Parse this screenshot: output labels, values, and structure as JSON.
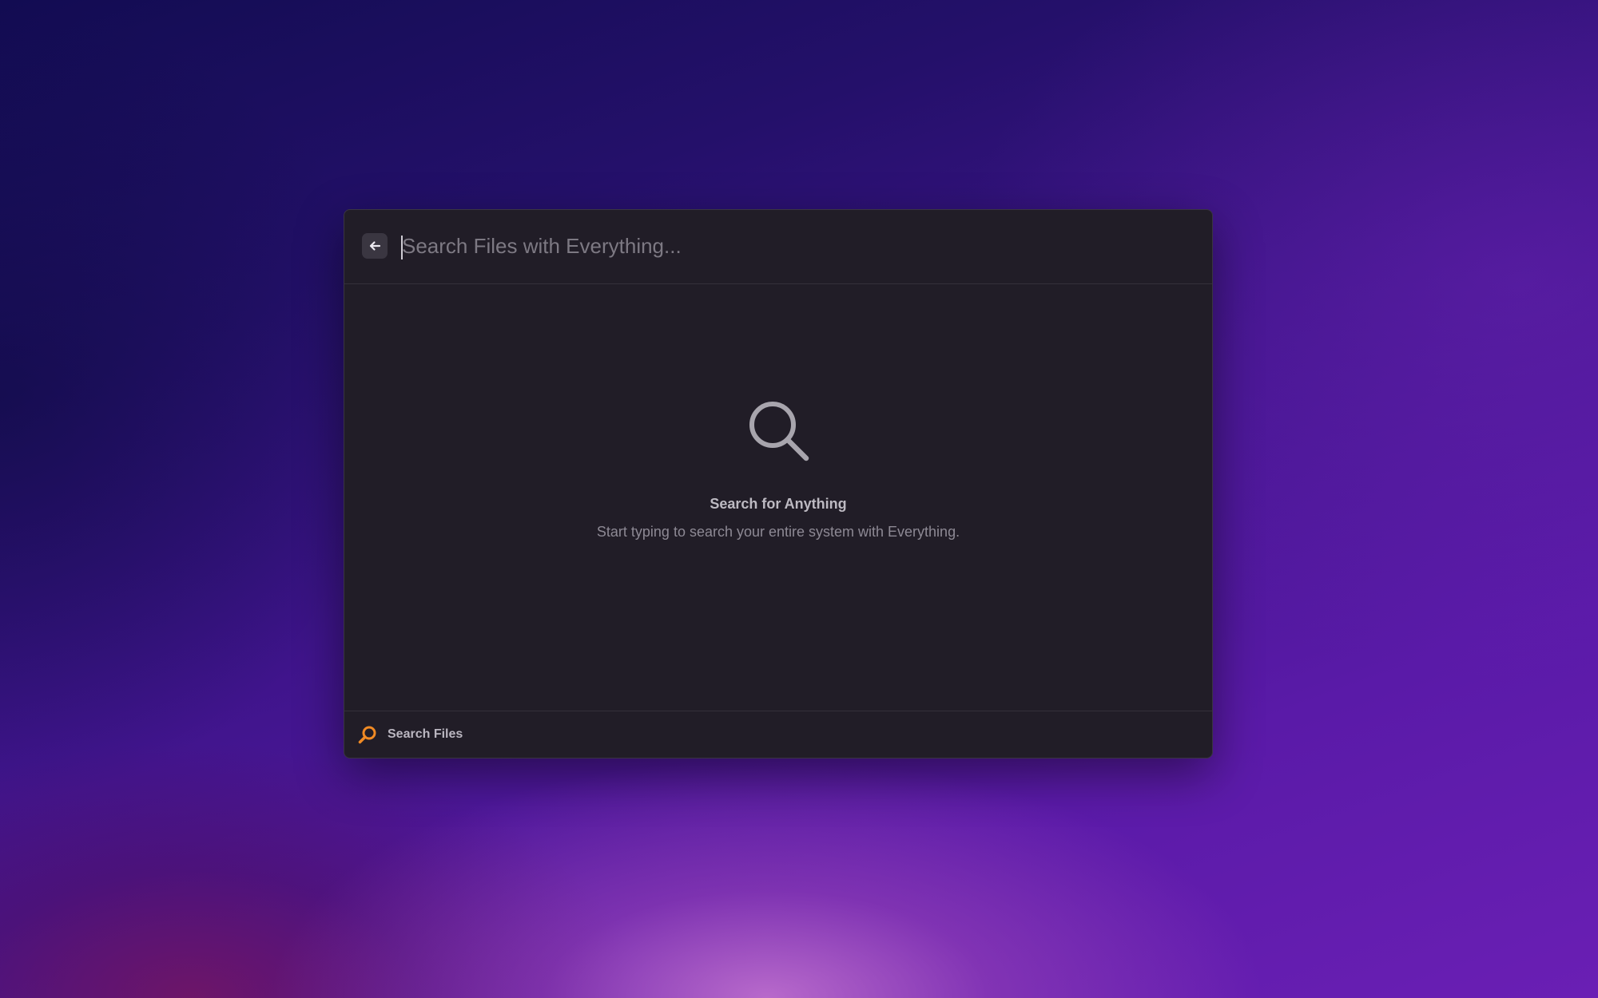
{
  "search": {
    "placeholder": "Search Files with Everything..."
  },
  "empty_state": {
    "title": "Search for Anything",
    "subtitle": "Start typing to search your entire system with Everything."
  },
  "footer": {
    "label": "Search Files",
    "icon": "search-icon",
    "icon_color": "#f08a24"
  },
  "header": {
    "back_icon": "arrow-left-icon"
  },
  "colors": {
    "window_background": "#211d27",
    "accent": "#f08a24"
  }
}
